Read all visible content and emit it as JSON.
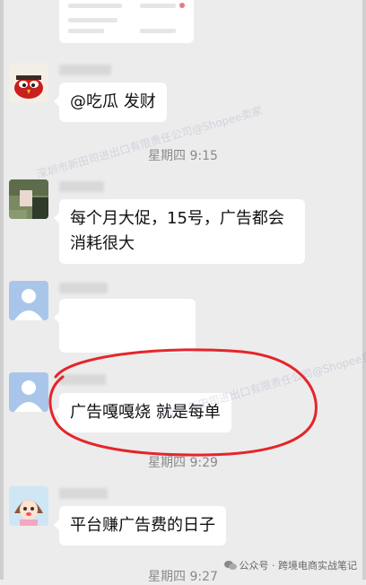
{
  "messages": [
    {
      "text": "@吃瓜 发财"
    },
    {
      "text_line1": "每个月大促，15号，广告都会",
      "text_line2": "消耗很大"
    },
    {
      "text": ""
    },
    {
      "text": "广告嘎嘎烧  就是每单"
    },
    {
      "text": "平台赚广告费的日子"
    }
  ],
  "timestamps": [
    "星期四 9:15",
    "星期四 9:29",
    "星期四 9:27"
  ],
  "watermark": "深圳市新田司进出口有限责任公司@Shopee卖家",
  "footer": {
    "icon": "wechat-icon",
    "label": "公众号 · 跨境电商实战笔记"
  },
  "colors": {
    "background": "#ececec",
    "bubble": "#ffffff",
    "highlight": "#e5252a"
  }
}
